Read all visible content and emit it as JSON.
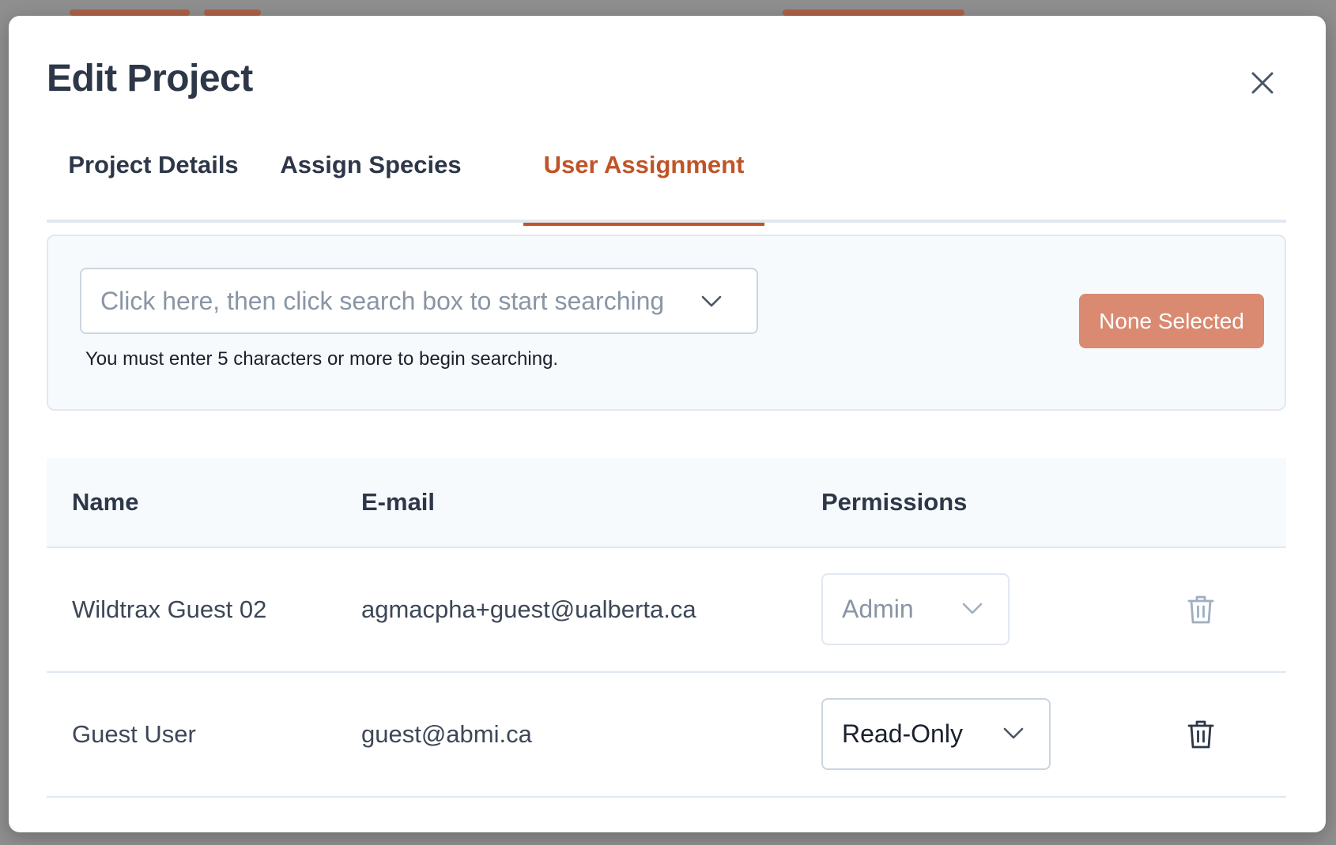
{
  "dialog": {
    "title": "Edit Project",
    "close_icon": "close-icon"
  },
  "tabs": [
    {
      "label": "Project Details",
      "active": false
    },
    {
      "label": "Assign Species",
      "active": false
    },
    {
      "label": "User Assignment",
      "active": true
    }
  ],
  "search": {
    "placeholder": "Click here, then click search box to start searching",
    "helper": "You must enter 5 characters or more to begin searching.",
    "button_label": "None Selected",
    "chevron_icon": "chevron-down-icon"
  },
  "table": {
    "headers": {
      "name": "Name",
      "email": "E-mail",
      "permissions": "Permissions"
    },
    "rows": [
      {
        "name": "Wildtrax Guest 02",
        "email": "agmacpha+guest@ualberta.ca",
        "permission": "Admin",
        "disabled": true
      },
      {
        "name": "Guest User",
        "email": "guest@abmi.ca",
        "permission": "Read-Only",
        "disabled": false
      }
    ],
    "delete_icon": "trash-icon"
  },
  "colors": {
    "accent": "#c05428",
    "button_disabled": "#d98a70",
    "title_text": "#2d3748",
    "panel_bg": "#f7fafc",
    "border": "#e2e8f0"
  }
}
